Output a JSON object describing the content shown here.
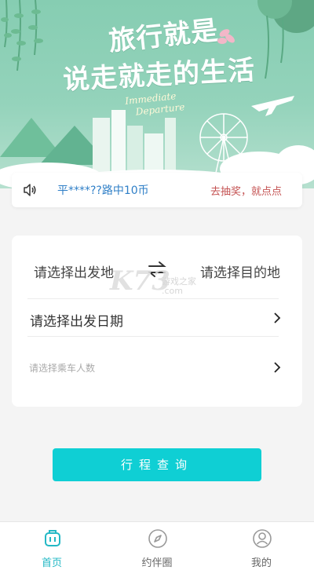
{
  "hero": {
    "title_line1": "旅行就是",
    "title_line2": "说走就走的生活",
    "subtitle_line1": "Immediate",
    "subtitle_line2": "Departure"
  },
  "notice": {
    "icon": "speaker-icon",
    "message": "平****??路中10币",
    "link": "去抽奖，就点点"
  },
  "search": {
    "from_placeholder": "请选择出发地",
    "to_placeholder": "请选择目的地",
    "swap_icon": "swap-icon",
    "date_placeholder": "请选择出发日期",
    "passengers_placeholder": "请选择乘车人数"
  },
  "watermark": {
    "brand": "K73",
    "line1": "游戏之家",
    "line2": ".com"
  },
  "button": {
    "label": "行程查询"
  },
  "tabbar": {
    "items": [
      {
        "label": "首页",
        "icon": "home-icon",
        "active": true
      },
      {
        "label": "约伴圈",
        "icon": "compass-icon",
        "active": false
      },
      {
        "label": "我的",
        "icon": "user-icon",
        "active": false
      }
    ]
  },
  "colors": {
    "accent": "#0fcfd4",
    "tab_active": "#23b8c5",
    "notice_text": "#2f7fc7",
    "notice_link": "#c45252"
  }
}
